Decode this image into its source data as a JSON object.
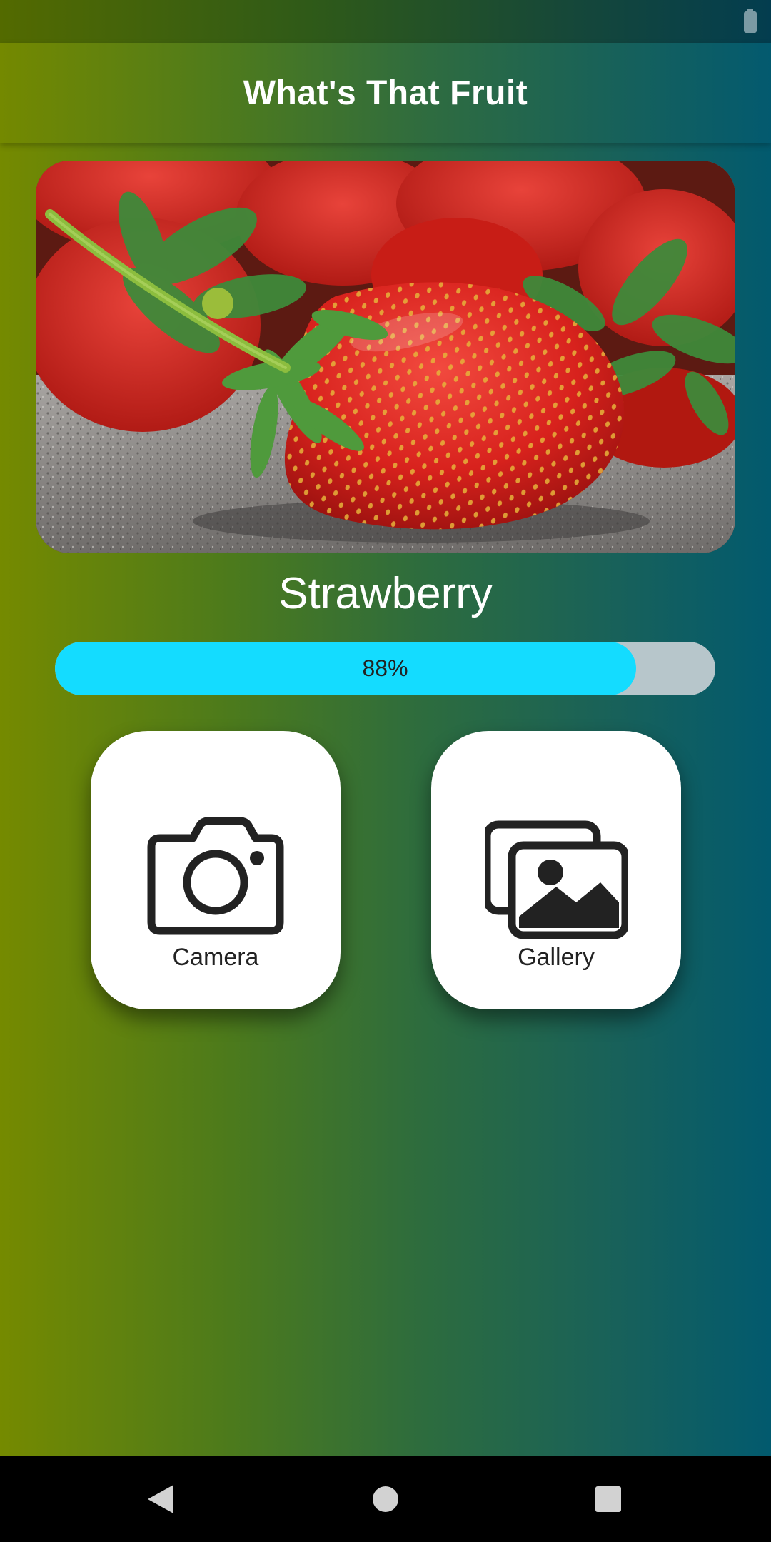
{
  "app": {
    "title": "What's That Fruit"
  },
  "result": {
    "fruit_name": "Strawberry",
    "confidence": 0.88,
    "confidence_label": "88%"
  },
  "actions": {
    "camera_label": "Camera",
    "gallery_label": "Gallery"
  },
  "icons": {
    "battery": "battery-icon",
    "camera": "camera-icon",
    "gallery": "gallery-icon",
    "back": "back-icon",
    "home": "home-icon",
    "recents": "recents-icon"
  },
  "colors": {
    "progress_fill": "#14dcff",
    "progress_track": "#b7c6cb",
    "icon": "#222222"
  }
}
